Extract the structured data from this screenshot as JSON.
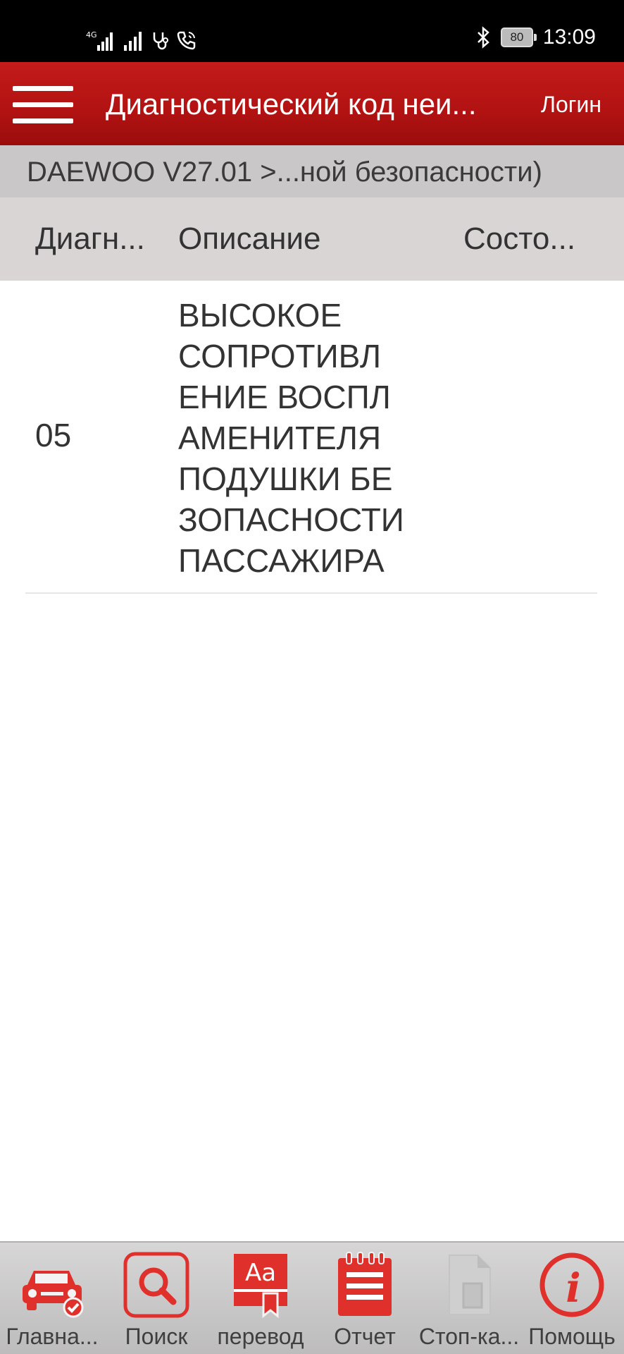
{
  "status_bar": {
    "network1": "4G",
    "battery": "80",
    "time": "13:09"
  },
  "header": {
    "title": "Диагностический код неи...",
    "login": "Логин"
  },
  "breadcrumb": "DAEWOO V27.01 >...ной безопасности)",
  "table": {
    "columns": [
      "Диагн...",
      "Описание",
      "Состо..."
    ],
    "rows": [
      {
        "code": "05",
        "description": "ВЫСОКОЕ\nСОПРОТИВЛ\nЕНИЕ ВОСПЛ\nАМЕНИТЕЛЯ\nПОДУШКИ БЕ\nЗОПАСНОСТИ\nПАССАЖИРА",
        "state": ""
      }
    ]
  },
  "bottom_nav": [
    {
      "label": "Главна...",
      "icon": "car-check-icon"
    },
    {
      "label": "Поиск",
      "icon": "search-icon"
    },
    {
      "label": "перевод",
      "icon": "translate-book-icon"
    },
    {
      "label": "Отчет",
      "icon": "report-notepad-icon"
    },
    {
      "label": "Стоп-ка...",
      "icon": "freeze-frame-document-icon"
    },
    {
      "label": "Помощь",
      "icon": "info-icon"
    }
  ],
  "colors": {
    "accent": "#b31414",
    "icon_red": "#e0302b"
  }
}
